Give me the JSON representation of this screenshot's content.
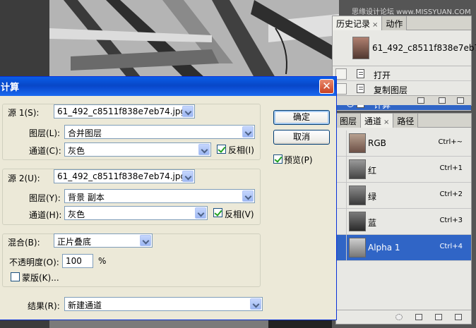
{
  "watermark": "思缘设计论坛 www.MISSYUAN.COM",
  "history_panel": {
    "tabs": [
      {
        "label": "历史记录",
        "close": "×"
      },
      {
        "label": "动作"
      }
    ],
    "snapshot_name": "61_492_c8511f838e7eb7...",
    "steps": [
      "打开",
      "复制图层",
      "计算"
    ],
    "selected_step": "计算"
  },
  "channels_panel": {
    "tabs": [
      {
        "label": "图层"
      },
      {
        "label": "通道",
        "close": "×"
      },
      {
        "label": "路径"
      }
    ],
    "channels": [
      {
        "name": "RGB",
        "shortcut": "Ctrl+~"
      },
      {
        "name": "红",
        "shortcut": "Ctrl+1"
      },
      {
        "name": "绿",
        "shortcut": "Ctrl+2"
      },
      {
        "name": "蓝",
        "shortcut": "Ctrl+3"
      },
      {
        "name": "Alpha 1",
        "shortcut": "Ctrl+4"
      }
    ],
    "selected_channel": "Alpha 1"
  },
  "dialog": {
    "title": "计算",
    "close": "✕",
    "source1": {
      "label": "源 1(S):",
      "file": "61_492_c8511f838e7eb74.jpg",
      "layer_label": "图层(L):",
      "layer": "合并图层",
      "channel_label": "通道(C):",
      "channel": "灰色",
      "invert_label": "反相(I)",
      "invert": true
    },
    "source2": {
      "label": "源 2(U):",
      "file": "61_492_c8511f838e7eb74.jpg",
      "layer_label": "图层(Y):",
      "layer": "背景 副本",
      "channel_label": "通道(H):",
      "channel": "灰色",
      "invert_label": "反相(V)",
      "invert": true
    },
    "blending": {
      "label": "混合(B):",
      "mode": "正片叠底",
      "opacity_label": "不透明度(O):",
      "opacity": "100",
      "opacity_unit": "%",
      "mask_label": "蒙版(K)...",
      "mask": false
    },
    "result": {
      "label": "结果(R):",
      "value": "新建通道"
    },
    "buttons": {
      "ok": "确定",
      "cancel": "取消"
    },
    "preview_label": "预览(P)",
    "preview": true
  }
}
